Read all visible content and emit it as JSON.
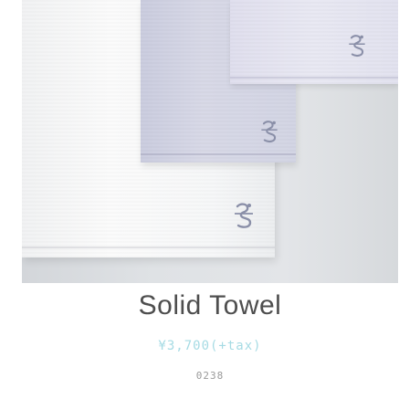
{
  "product": {
    "name": "Solid Towel",
    "price": "¥3,700(+tax)",
    "code": "0238"
  },
  "photo": {
    "subject": "towels-photo",
    "towels": [
      "white",
      "grey",
      "lavender"
    ],
    "colors": {
      "white": "#f6f7f8",
      "grey": "#d3d5e4",
      "lavender": "#e6e6f1",
      "embroidery": "#8a8fa8"
    }
  },
  "colors": {
    "title": "#4e4e4e",
    "price": "#a6dbe4",
    "code": "#9a9a9a"
  }
}
